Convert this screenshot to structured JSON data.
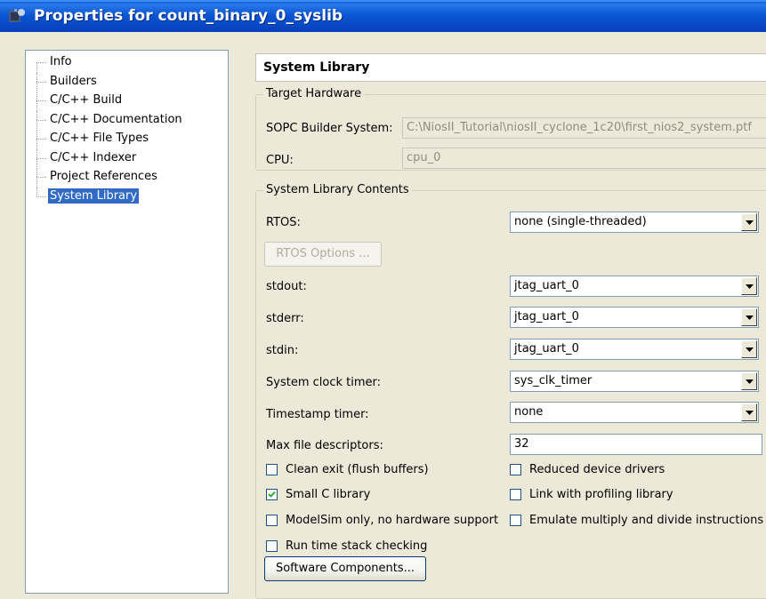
{
  "window": {
    "title": "Properties for count_binary_0_syslib",
    "icon": "eclipse-properties-icon"
  },
  "nav": {
    "items": [
      {
        "label": "Info",
        "selected": false
      },
      {
        "label": "Builders",
        "selected": false
      },
      {
        "label": "C/C++ Build",
        "selected": false
      },
      {
        "label": "C/C++ Documentation",
        "selected": false
      },
      {
        "label": "C/C++ File Types",
        "selected": false
      },
      {
        "label": "C/C++ Indexer",
        "selected": false
      },
      {
        "label": "Project References",
        "selected": false
      },
      {
        "label": "System Library",
        "selected": true
      }
    ]
  },
  "page": {
    "title": "System Library",
    "target_hardware": {
      "group_title": "Target Hardware",
      "sopc_label": "SOPC Builder System:",
      "sopc_value": "C:\\NiosII_Tutorial\\niosII_cyclone_1c20\\first_nios2_system.ptf",
      "cpu_label": "CPU:",
      "cpu_value": "cpu_0"
    },
    "contents": {
      "group_title": "System Library Contents",
      "rtos_label": "RTOS:",
      "rtos_value": "none (single-threaded)",
      "rtos_options_button": "RTOS Options ...",
      "stdout_label": "stdout:",
      "stdout_value": "jtag_uart_0",
      "stderr_label": "stderr:",
      "stderr_value": "jtag_uart_0",
      "stdin_label": "stdin:",
      "stdin_value": "jtag_uart_0",
      "sys_clk_label": "System clock timer:",
      "sys_clk_value": "sys_clk_timer",
      "timestamp_label": "Timestamp timer:",
      "timestamp_value": "none",
      "max_fd_label": "Max file descriptors:",
      "max_fd_value": "32",
      "checkboxes": {
        "clean_exit": {
          "label": "Clean exit (flush buffers)",
          "checked": false
        },
        "reduced_drivers": {
          "label": "Reduced device drivers",
          "checked": false
        },
        "small_c": {
          "label": "Small C library",
          "checked": true
        },
        "profiling": {
          "label": "Link with profiling library",
          "checked": false
        },
        "modelsim": {
          "label": "ModelSim only, no hardware support",
          "checked": false
        },
        "emulate_mul": {
          "label": "Emulate multiply and divide instructions",
          "checked": false
        },
        "stack_check": {
          "label": "Run time stack checking",
          "checked": false
        }
      },
      "software_components_button": "Software Components..."
    }
  },
  "colors": {
    "titlebar": "#0a55d2",
    "selection": "#316ac5",
    "face": "#ece9d8",
    "field_border": "#7f9db9"
  }
}
